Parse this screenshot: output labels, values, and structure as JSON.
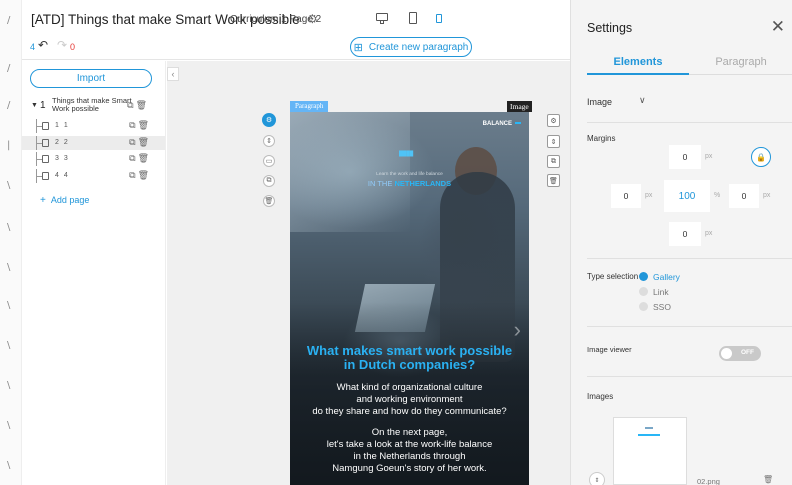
{
  "gutter": {
    "marks": [
      "/",
      "/",
      "/",
      "|",
      "\\",
      "\\",
      "\\",
      "\\",
      "\\",
      "\\",
      "\\",
      "\\"
    ]
  },
  "header": {
    "title": "[ATD] Things that  make Smart Work possible",
    "breadcrumb": "Curriculum 1 Page 2",
    "undo_count": "4",
    "redo_count": "0",
    "create_paragraph_label": "Create new paragraph"
  },
  "sidebar": {
    "import_label": "Import",
    "root": {
      "number": "1",
      "label": "Things that make Smart Work possible"
    },
    "pages": [
      {
        "nums": "1 1",
        "active": false
      },
      {
        "nums": "2 2",
        "active": true
      },
      {
        "nums": "3 3",
        "active": false
      },
      {
        "nums": "4 4",
        "active": false
      }
    ],
    "add_page_label": "Add page"
  },
  "canvas": {
    "paragraph_tag": "Paragraph",
    "image_tag": "Image",
    "photo": {
      "corner_label": "BALANCE",
      "badge": "████",
      "hero_small": "Learn the work and life balance",
      "hero_line_prefix": "IN THE ",
      "hero_line_bold": "NETHERLANDS",
      "headline_1": "What makes smart work possible",
      "headline_2": "in Dutch companies?",
      "body1_l1": "What kind of organizational culture",
      "body1_l2": "and working environment",
      "body1_l3": "do they share and how do they communicate?",
      "body2_l1": "On the next page,",
      "body2_l2": "let's take a look at the work-life balance",
      "body2_l3": "in the Netherlands through",
      "body2_l4": "Namgung Goeun's story of her work."
    }
  },
  "settings": {
    "title": "Settings",
    "tabs": [
      "Elements",
      "Paragraph"
    ],
    "active_tab": "Elements",
    "element_type": "Image",
    "margins_label": "Margins",
    "margins": {
      "top": "0",
      "left": "0",
      "width": "100",
      "right": "0",
      "bottom": "0",
      "unit_px": "px",
      "unit_pct": "%"
    },
    "type_selection_label": "Type selection",
    "type_options": [
      {
        "label": "Gallery",
        "selected": true
      },
      {
        "label": "Link",
        "selected": false
      },
      {
        "label": "SSO",
        "selected": false
      }
    ],
    "image_viewer_label": "Image viewer",
    "image_viewer_state": "OFF",
    "images_label": "Images",
    "image_file": "02.png",
    "accent": "#2196d9"
  }
}
